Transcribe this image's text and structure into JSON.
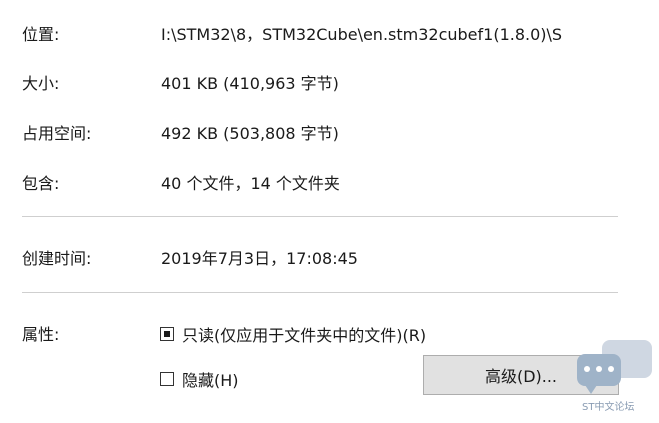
{
  "properties": {
    "location": {
      "label": "位置:",
      "value": "I:\\STM32\\8，STM32Cube\\en.stm32cubef1(1.8.0)\\S"
    },
    "size": {
      "label": "大小:",
      "value": "401 KB (410,963 字节)"
    },
    "size_on_disk": {
      "label": "占用空间:",
      "value": "492 KB (503,808 字节)"
    },
    "contains": {
      "label": "包含:",
      "value": "40 个文件，14 个文件夹"
    },
    "created": {
      "label": "创建时间:",
      "value": "2019年7月3日，17:08:45"
    }
  },
  "attributes": {
    "label": "属性:",
    "readonly": {
      "label": "只读(仅应用于文件夹中的文件)(R)",
      "state": "indeterminate"
    },
    "hidden": {
      "label": "隐藏(H)",
      "state": "unchecked"
    },
    "advanced_button": "高级(D)..."
  },
  "watermark": {
    "text": "ST中文论坛",
    "icon": "chat-bubble-icon"
  }
}
